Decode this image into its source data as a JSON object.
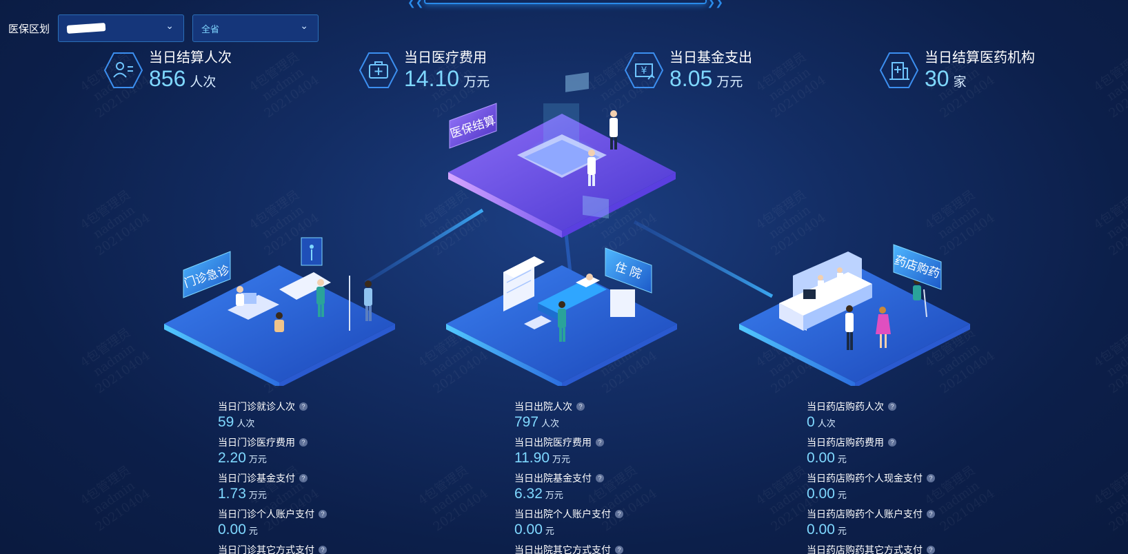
{
  "filter": {
    "region_label": "医保区划",
    "region_select_value": "",
    "scope_select_value": "全省"
  },
  "kpis": [
    {
      "label": "当日结算人次",
      "value": "856",
      "unit": "人次",
      "icon": "person-card-icon"
    },
    {
      "label": "当日医疗费用",
      "value": "14.10",
      "unit": "万元",
      "icon": "medical-kit-icon"
    },
    {
      "label": "当日基金支出",
      "value": "8.05",
      "unit": "万元",
      "icon": "yuan-fund-icon"
    },
    {
      "label": "当日结算医药机构",
      "value": "30",
      "unit": "家",
      "icon": "hospital-building-icon"
    }
  ],
  "scenes": {
    "center_sign": "医保结算",
    "left_sign": "门诊急诊",
    "middle_sign": "住 院",
    "right_sign": "药店购药"
  },
  "outpatient": [
    {
      "label": "当日门诊就诊人次",
      "value": "59",
      "unit": "人次"
    },
    {
      "label": "当日门诊医疗费用",
      "value": "2.20",
      "unit": "万元"
    },
    {
      "label": "当日门诊基金支付",
      "value": "1.73",
      "unit": "万元"
    },
    {
      "label": "当日门诊个人账户支付",
      "value": "0.00",
      "unit": "元"
    },
    {
      "label": "当日门诊其它方式支付",
      "value": "",
      "unit": ""
    }
  ],
  "inpatient": [
    {
      "label": "当日出院人次",
      "value": "797",
      "unit": "人次"
    },
    {
      "label": "当日出院医疗费用",
      "value": "11.90",
      "unit": "万元"
    },
    {
      "label": "当日出院基金支付",
      "value": "6.32",
      "unit": "万元"
    },
    {
      "label": "当日出院个人账户支付",
      "value": "0.00",
      "unit": "元"
    },
    {
      "label": "当日出院其它方式支付",
      "value": "",
      "unit": ""
    }
  ],
  "pharmacy": [
    {
      "label": "当日药店购药人次",
      "value": "0",
      "unit": "人次"
    },
    {
      "label": "当日药店购药费用",
      "value": "0.00",
      "unit": "元"
    },
    {
      "label": "当日药店购药个人现金支付",
      "value": "0.00",
      "unit": "元"
    },
    {
      "label": "当日药店购药个人账户支付",
      "value": "0.00",
      "unit": "元"
    },
    {
      "label": "当日药店购药其它方式支付",
      "value": "",
      "unit": ""
    }
  ],
  "help_glyph": "?",
  "dropdown_glyph": "⌄",
  "watermark": [
    "4包管理员",
    "nadmin",
    "20210404"
  ],
  "colors": {
    "accent": "#7fd8ff",
    "panel_border": "#2b6fb8",
    "platform_purple": "#6a4de8",
    "platform_blue": "#2f6fe0"
  }
}
